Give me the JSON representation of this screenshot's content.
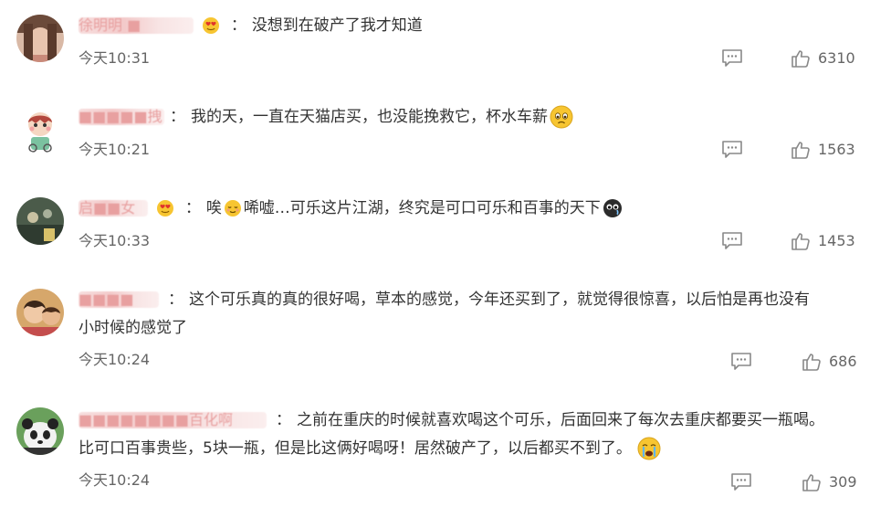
{
  "comments": [
    {
      "username": "徐明明 ■",
      "separator": "：",
      "text_parts": [
        "没想到在破产了我才知道"
      ],
      "time": "今天10:31",
      "likes": "6310",
      "user_badge": "heart-eyes-badge-icon",
      "avatar_icon": "user-avatar-icon"
    },
    {
      "username": "■■■■■拽",
      "separator": "：",
      "text_parts": [
        "我的天，一直在天猫店买，也没能挽救它，杯水车薪"
      ],
      "time": "今天10:21",
      "likes": "1563",
      "trailing_emoji": "sad-face-emoji-icon",
      "avatar_icon": "user-avatar-icon"
    },
    {
      "username": "启■■女",
      "separator": "：",
      "text_parts": [
        "唉",
        "唏嘘…可乐这片江湖，终究是可口可乐和百事的天下"
      ],
      "time": "今天10:33",
      "likes": "1453",
      "user_badge": "heart-eyes-badge-icon",
      "inline_emoji": "relieved-face-emoji-icon",
      "trailing_emoji": "crying-black-emoji-icon",
      "avatar_icon": "user-avatar-icon"
    },
    {
      "username": "■■■■",
      "separator": "：",
      "text_parts": [
        "这个可乐真的真的很好喝，草本的感觉，今年还买到了，就觉得很惊喜，以后怕是再也没有",
        "小时候的感觉了"
      ],
      "time": "今天10:24",
      "likes": "686",
      "avatar_icon": "user-avatar-icon"
    },
    {
      "username": "■■■■■■■■百化啊",
      "separator": "：",
      "text_parts": [
        "之前在重庆的时候就喜欢喝这个可乐，后面回来了每次去重庆都要买一瓶喝。",
        "比可口百事贵些，5块一瓶，但是比这俩好喝呀！居然破产了，以后都买不到了。"
      ],
      "time": "今天10:24",
      "likes": "309",
      "trailing_emoji": "crying-face-emoji-icon",
      "avatar_icon": "user-avatar-icon"
    }
  ],
  "colors": {
    "text": "#333333",
    "meta": "#666666",
    "username_blur": "#f3caca",
    "emoji_yellow": "#f7c531",
    "icon_gray": "#888888"
  }
}
